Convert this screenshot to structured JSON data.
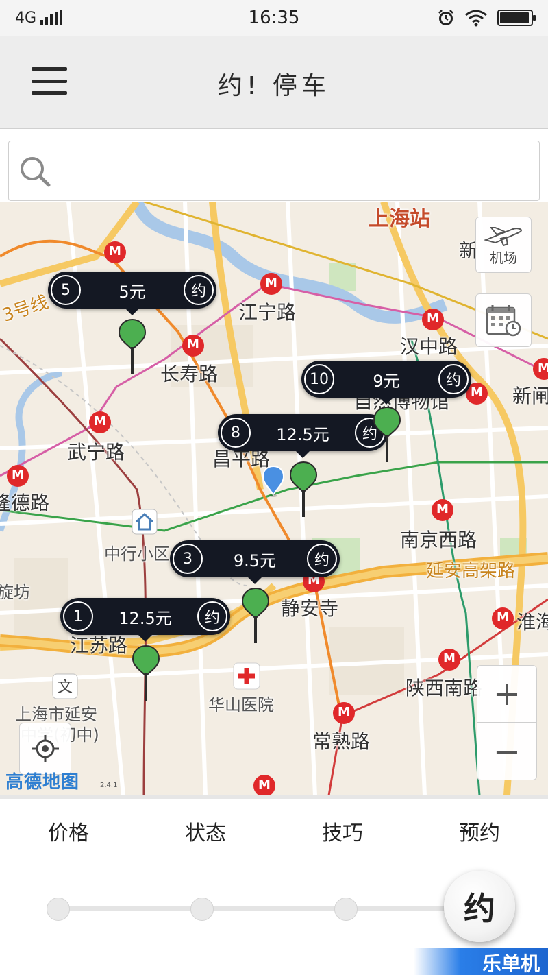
{
  "status_bar": {
    "network": "4G",
    "time": "16:35",
    "battery_level": 0.95
  },
  "header": {
    "title": "约! 停车"
  },
  "search": {
    "value": "",
    "placeholder": ""
  },
  "map": {
    "brand_label": "上海站",
    "road_labels": {
      "jiangning": "江宁路",
      "changshou": "长寿路",
      "wuning": "武宁路",
      "changping": "昌平路",
      "hanzhong": "汉中路",
      "xinzha": "新闸",
      "natural_history": "自然博物馆",
      "longde": "隆德路",
      "zhongxing": "中行小区",
      "nanjing_west": "南京西路",
      "yanan_elevated": "延安高架路",
      "xuanfang": "旋坊",
      "jingan_temple": "静安寺",
      "huaihai": "淮海",
      "jiangsu": "江苏路",
      "huashan_hospital": "华山医院",
      "shaanxi_south": "陕西南路",
      "yanan_school_1": "上海市延安",
      "yanan_school_2": "中学(初中)",
      "changshu": "常熟路",
      "xin_top": "新",
      "line3": "3号线"
    },
    "airport_label": "机场",
    "zoom_in_label": "+",
    "zoom_out_label": "−",
    "amap_logo": "高德地图",
    "amap_version": "2.4.1",
    "parking_spots": [
      {
        "count": "5",
        "price": "5元",
        "book": "约"
      },
      {
        "count": "10",
        "price": "9元",
        "book": "约"
      },
      {
        "count": "8",
        "price": "12.5元",
        "book": "约"
      },
      {
        "count": "3",
        "price": "9.5元",
        "book": "约"
      },
      {
        "count": "1",
        "price": "12.5元",
        "book": "约"
      }
    ],
    "colors": {
      "pin": "#4caf50",
      "bubble": "#141823",
      "metro": "#e0282a",
      "current_location": "#4a90e2"
    }
  },
  "tabs": {
    "price": "价格",
    "status": "状态",
    "tips": "技巧",
    "reserve": "预约"
  },
  "book_button": "约",
  "watermark": "乐单机"
}
